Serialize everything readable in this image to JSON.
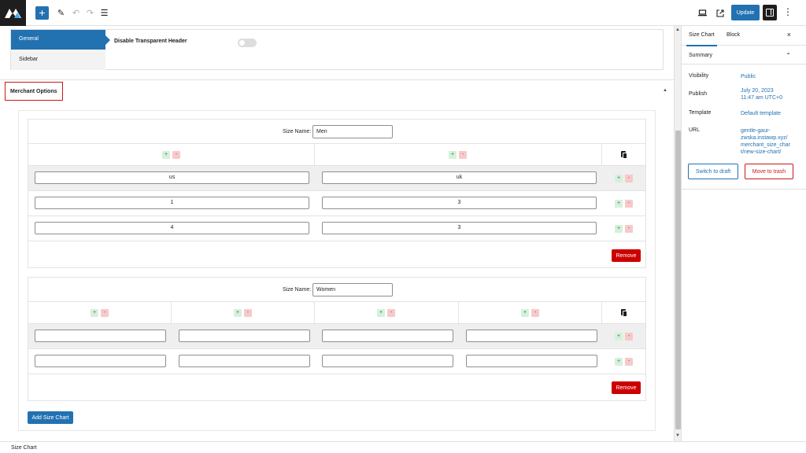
{
  "toolbar": {
    "add_icon": "plus-icon",
    "update_label": "Update"
  },
  "settings": {
    "tabs": [
      "General",
      "Sidebar"
    ],
    "option_label": "Disable Transparent Header",
    "option_enabled": false
  },
  "merchant": {
    "title": "Merchant Options",
    "size_name_label": "Size Name:",
    "charts": [
      {
        "size_name": "Men",
        "rows": [
          [
            "us",
            "uk"
          ],
          [
            "1",
            "3"
          ],
          [
            "4",
            "3"
          ]
        ],
        "remove_label": "Remove"
      },
      {
        "size_name": "Women",
        "rows": [
          [
            "",
            "",
            "",
            ""
          ],
          [
            "",
            "",
            "",
            ""
          ]
        ],
        "remove_label": "Remove"
      }
    ],
    "add_label": "Add Size Chart",
    "plus": "+",
    "minus": "-"
  },
  "sidebar": {
    "tabs": [
      "Size Chart",
      "Block"
    ],
    "close": "×",
    "summary": "Summary",
    "visibility_label": "Visibility",
    "visibility_value": "Public",
    "publish_label": "Publish",
    "publish_value_1": "July 20, 2023",
    "publish_value_2": "11:47 am UTC+0",
    "template_label": "Template",
    "template_value": "Default template",
    "url_label": "URL",
    "url_lines": [
      "gentle-gaur-",
      "zwska.instawp.xyz/",
      "merchant_size_char",
      "t/new-size-chart/"
    ],
    "switch_draft": "Switch to draft",
    "move_trash": "Move to trash"
  },
  "footer": {
    "breadcrumb": "Size Chart"
  }
}
